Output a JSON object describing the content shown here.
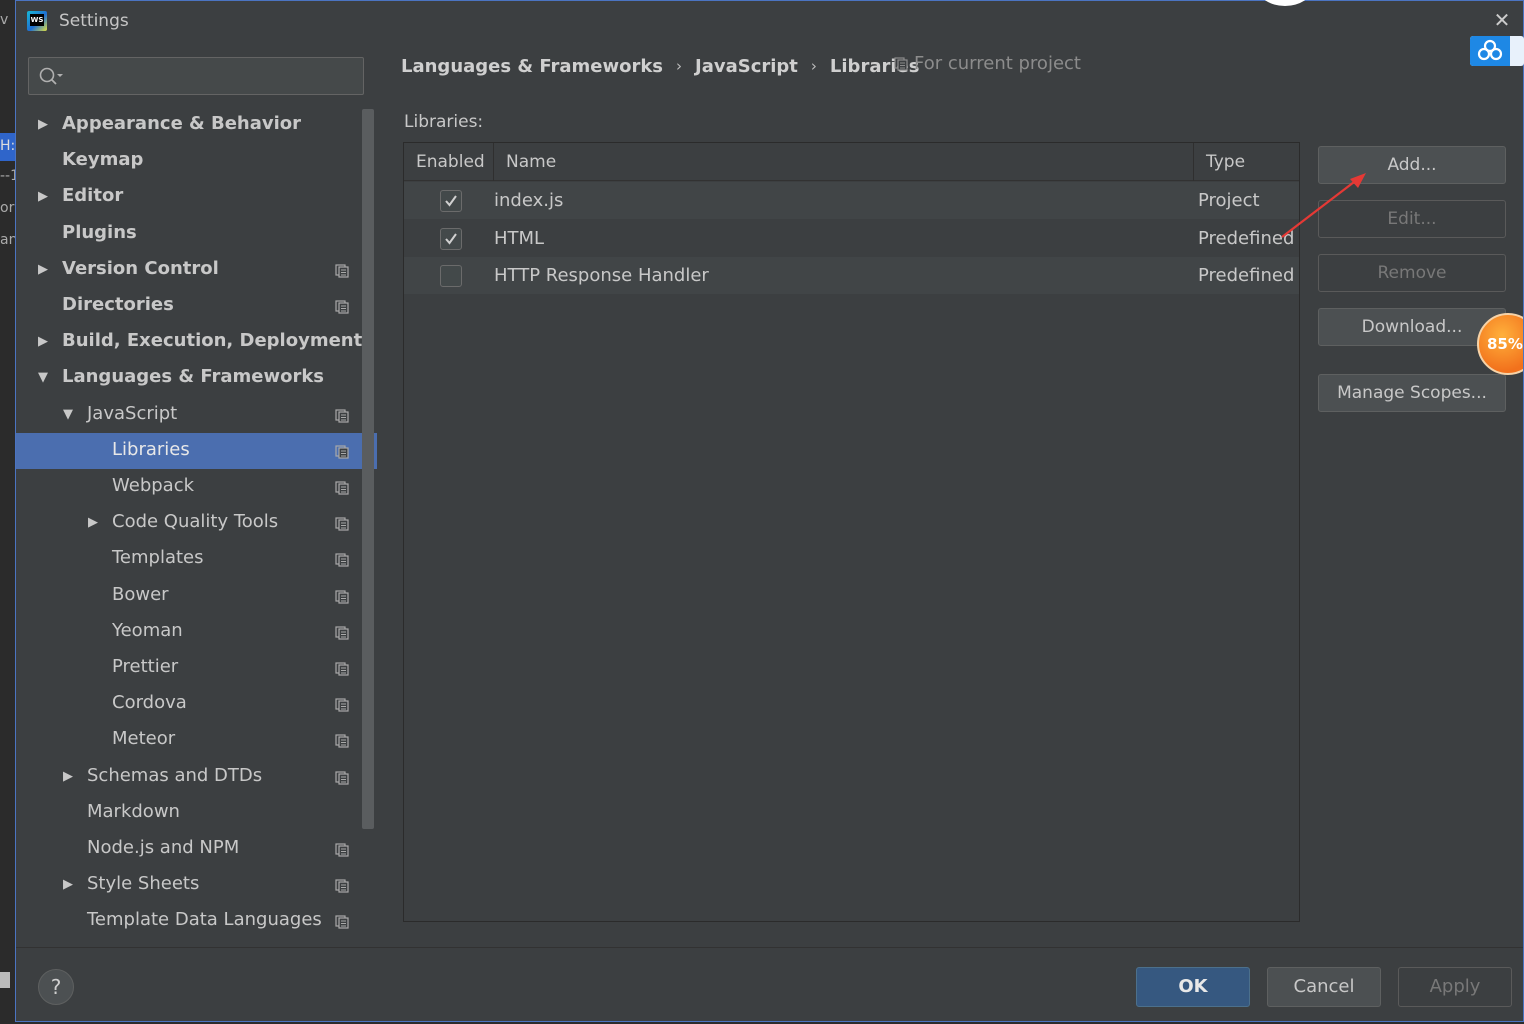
{
  "window": {
    "title": "Settings",
    "close_symbol": "✕"
  },
  "background_fragments": [
    "v",
    "H:\\",
    "--1",
    "ora",
    "and"
  ],
  "search": {
    "placeholder": "",
    "value": ""
  },
  "sidebar": {
    "items": [
      {
        "label": "Appearance & Behavior",
        "expandable": true,
        "expanded": false,
        "level": 0,
        "bold": true,
        "project_scoped": false
      },
      {
        "label": "Keymap",
        "expandable": false,
        "level": 0,
        "bold": true,
        "project_scoped": false
      },
      {
        "label": "Editor",
        "expandable": true,
        "expanded": false,
        "level": 0,
        "bold": true,
        "project_scoped": false
      },
      {
        "label": "Plugins",
        "expandable": false,
        "level": 0,
        "bold": true,
        "project_scoped": false
      },
      {
        "label": "Version Control",
        "expandable": true,
        "expanded": false,
        "level": 0,
        "bold": true,
        "project_scoped": true
      },
      {
        "label": "Directories",
        "expandable": false,
        "level": 0,
        "bold": true,
        "project_scoped": true
      },
      {
        "label": "Build, Execution, Deployment",
        "expandable": true,
        "expanded": false,
        "level": 0,
        "bold": true,
        "project_scoped": false
      },
      {
        "label": "Languages & Frameworks",
        "expandable": true,
        "expanded": true,
        "level": 0,
        "bold": true,
        "project_scoped": false
      },
      {
        "label": "JavaScript",
        "expandable": true,
        "expanded": true,
        "level": 1,
        "bold": false,
        "project_scoped": true
      },
      {
        "label": "Libraries",
        "expandable": false,
        "level": 2,
        "bold": false,
        "project_scoped": true,
        "selected": true
      },
      {
        "label": "Webpack",
        "expandable": false,
        "level": 2,
        "bold": false,
        "project_scoped": true
      },
      {
        "label": "Code Quality Tools",
        "expandable": true,
        "expanded": false,
        "level": 2,
        "bold": false,
        "project_scoped": true
      },
      {
        "label": "Templates",
        "expandable": false,
        "level": 2,
        "bold": false,
        "project_scoped": true
      },
      {
        "label": "Bower",
        "expandable": false,
        "level": 2,
        "bold": false,
        "project_scoped": true
      },
      {
        "label": "Yeoman",
        "expandable": false,
        "level": 2,
        "bold": false,
        "project_scoped": true
      },
      {
        "label": "Prettier",
        "expandable": false,
        "level": 2,
        "bold": false,
        "project_scoped": true
      },
      {
        "label": "Cordova",
        "expandable": false,
        "level": 2,
        "bold": false,
        "project_scoped": true
      },
      {
        "label": "Meteor",
        "expandable": false,
        "level": 2,
        "bold": false,
        "project_scoped": true
      },
      {
        "label": "Schemas and DTDs",
        "expandable": true,
        "expanded": false,
        "level": 1,
        "bold": false,
        "project_scoped": true
      },
      {
        "label": "Markdown",
        "expandable": false,
        "level": 1,
        "bold": false,
        "project_scoped": false
      },
      {
        "label": "Node.js and NPM",
        "expandable": false,
        "level": 1,
        "bold": false,
        "project_scoped": true
      },
      {
        "label": "Style Sheets",
        "expandable": true,
        "expanded": false,
        "level": 1,
        "bold": false,
        "project_scoped": true
      },
      {
        "label": "Template Data Languages",
        "expandable": false,
        "level": 1,
        "bold": false,
        "project_scoped": true
      }
    ]
  },
  "breadcrumb": {
    "items": [
      "Languages & Frameworks",
      "JavaScript",
      "Libraries"
    ],
    "separator": "›",
    "scope_hint": "For current project"
  },
  "libraries": {
    "label": "Libraries:",
    "columns": [
      "Enabled",
      "Name",
      "Type"
    ],
    "rows": [
      {
        "enabled": true,
        "name": "index.js",
        "type": "Project"
      },
      {
        "enabled": true,
        "name": "HTML",
        "type": "Predefined"
      },
      {
        "enabled": false,
        "name": "HTTP Response Handler",
        "type": "Predefined"
      }
    ]
  },
  "actions": {
    "add": "Add...",
    "edit": "Edit...",
    "remove": "Remove",
    "download": "Download...",
    "manage_scopes": "Manage Scopes..."
  },
  "overlay": {
    "progress_text": "85%",
    "progress_value": 85
  },
  "footer": {
    "help": "?",
    "ok": "OK",
    "cancel": "Cancel",
    "apply": "Apply"
  },
  "colors": {
    "accent_selected": "#4b6eaf",
    "ok_button": "#365880",
    "annotation_arrow": "#e53935",
    "progress_bubble": "#f2711c"
  }
}
